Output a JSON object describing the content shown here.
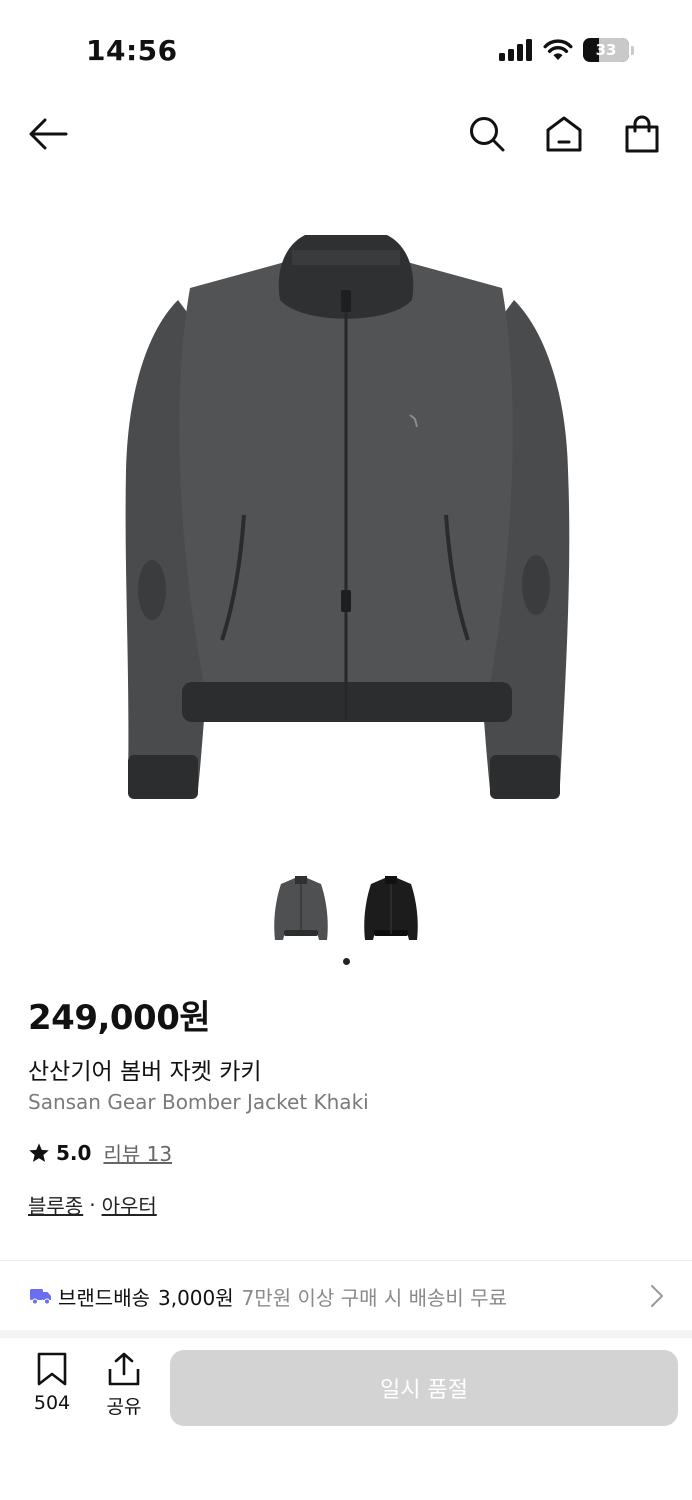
{
  "status_bar": {
    "time": "14:56",
    "battery": "33",
    "icons": [
      "cellular-signal-icon",
      "wifi-icon",
      "battery-icon"
    ]
  },
  "nav": {
    "icons": [
      "back-arrow-icon",
      "search-icon",
      "home-icon",
      "shopping-bag-icon"
    ]
  },
  "product": {
    "price": "249,000원",
    "name_ko": "산산기어 봄버 자켓 카키",
    "name_en": "Sansan Gear Bomber Jacket Khaki",
    "rating": "5.0",
    "review_label": "리뷰 13",
    "category_primary": "블루종",
    "category_separator": "·",
    "category_secondary": "아우터",
    "thumbnails": [
      "jacket-khaki-thumb",
      "jacket-black-thumb"
    ],
    "active_thumbnail_index": 0
  },
  "shipping": {
    "label": "브랜드배송",
    "cost": "3,000원",
    "note": "7만원 이상 구매 시 배송비 무료",
    "icon_color": "#6b6ef0"
  },
  "bottom_bar": {
    "bookmark_count": "504",
    "share_label": "공유",
    "soldout_label": "일시 품절",
    "soldout_color": "#d3d3d3"
  }
}
